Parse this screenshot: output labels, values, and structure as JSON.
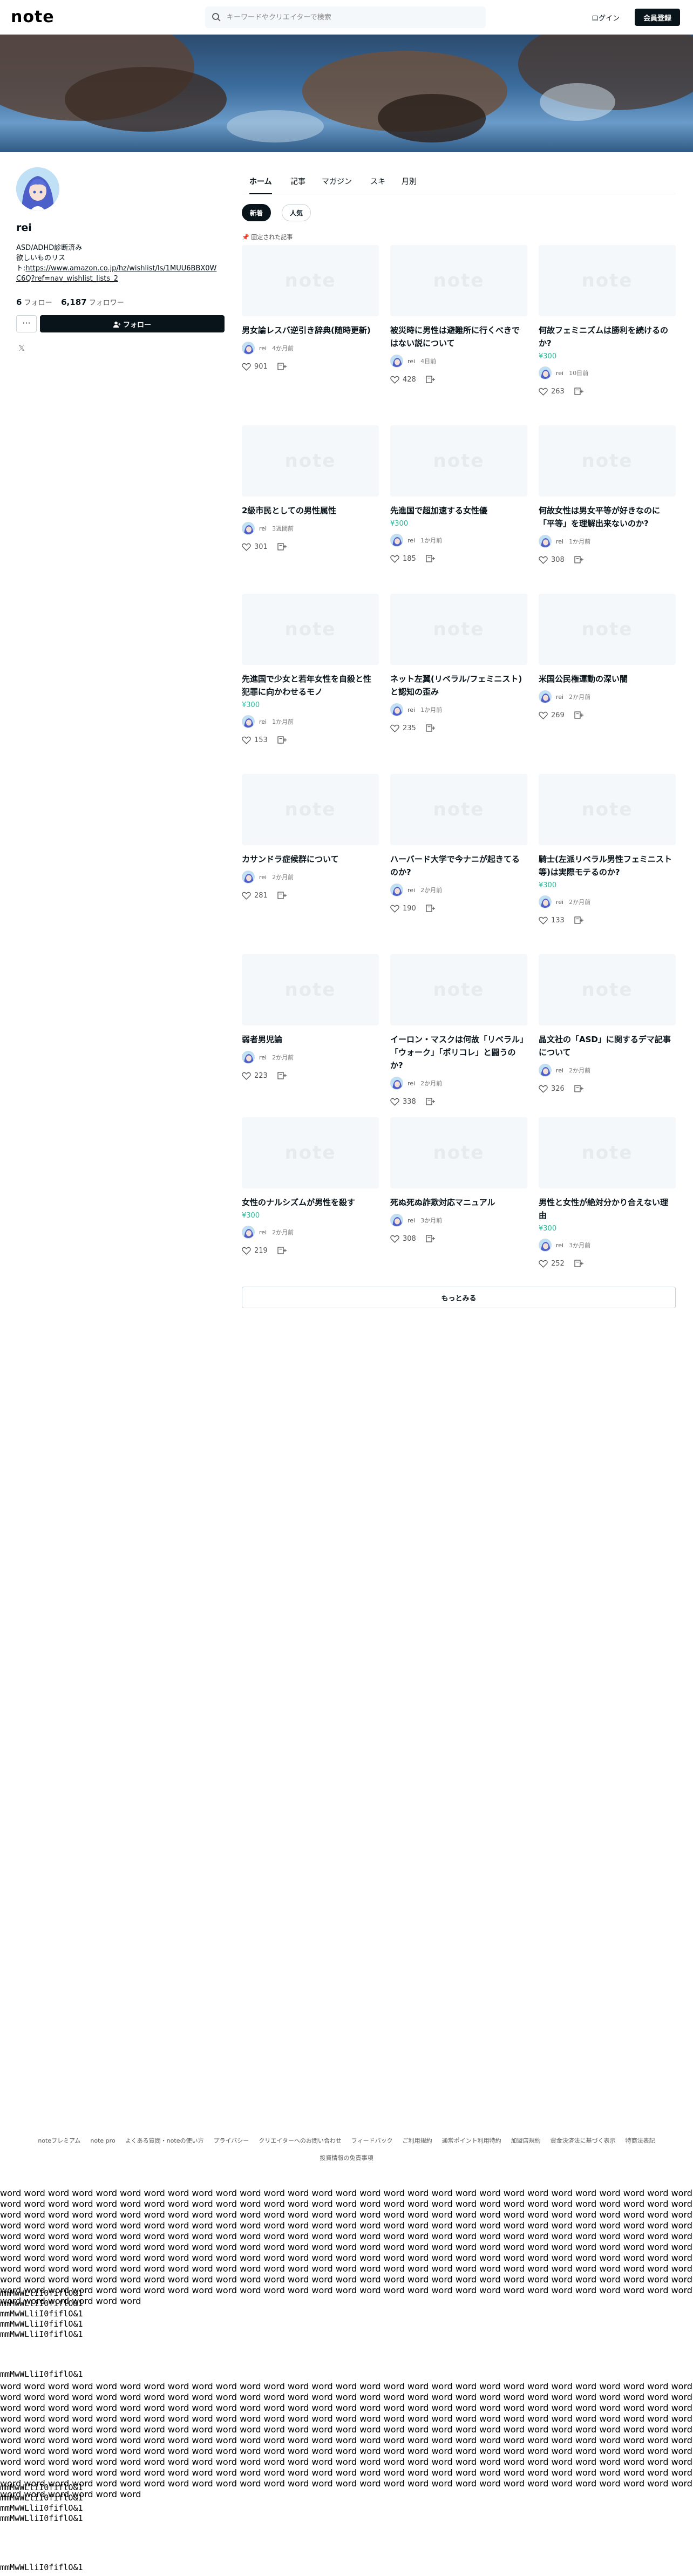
{
  "header": {
    "logo": "note",
    "search_placeholder": "キーワードやクリエイターで検索",
    "login": "ログイン",
    "signup": "会員登録"
  },
  "profile": {
    "name": "rei",
    "bio_line1": "ASD/ADHD診断済み",
    "bio_line2": "欲しいものリス",
    "bio_link_prefix": "ト:",
    "bio_link": "https://www.amazon.co.jp/hz/wishlist/ls/1MUU6BBX0WC6Q?ref=nav_wishlist_lists_2",
    "follow_count": "6",
    "follow_label": "フォロー",
    "follower_count": "6,187",
    "follower_label": "フォロワー",
    "more": "···",
    "follow_button": "フォロー"
  },
  "tabs": [
    "ホーム",
    "記事",
    "マガジン",
    "スキ",
    "月別"
  ],
  "subtabs": [
    "新着",
    "人気"
  ],
  "pinned_label": "固定された記事",
  "thumb_logo": "note",
  "articles": [
    {
      "title": "男女論レスバ逆引き辞典(随時更新)",
      "price": "",
      "author": "rei",
      "date": "4か月前",
      "likes": "901"
    },
    {
      "title": "被災時に男性は避難所に行くべきではない説について",
      "price": "",
      "author": "rei",
      "date": "4日前",
      "likes": "428"
    },
    {
      "title": "何故フェミニズムは勝利を続けるのか?",
      "price": "¥300",
      "author": "rei",
      "date": "10日前",
      "likes": "263"
    },
    {
      "title": "2級市民としての男性属性",
      "price": "",
      "author": "rei",
      "date": "3週間前",
      "likes": "301"
    },
    {
      "title": "先進国で超加速する女性優",
      "price": "¥300",
      "author": "rei",
      "date": "1か月前",
      "likes": "185"
    },
    {
      "title": "何故女性は男女平等が好きなのに「平等」を理解出来ないのか?",
      "price": "",
      "author": "rei",
      "date": "1か月前",
      "likes": "308"
    },
    {
      "title": "先進国で少女と若年女性を自殺と性犯罪に向かわせるモノ",
      "price": "¥300",
      "author": "rei",
      "date": "1か月前",
      "likes": "153"
    },
    {
      "title": "ネット左翼(リベラル/フェミニスト)と認知の歪み",
      "price": "",
      "author": "rei",
      "date": "1か月前",
      "likes": "235"
    },
    {
      "title": "米国公民権運動の深い闇",
      "price": "",
      "author": "rei",
      "date": "2か月前",
      "likes": "269"
    },
    {
      "title": "カサンドラ症候群について",
      "price": "",
      "author": "rei",
      "date": "2か月前",
      "likes": "281"
    },
    {
      "title": "ハーバード大学で今ナニが起きてるのか?",
      "price": "",
      "author": "rei",
      "date": "2か月前",
      "likes": "190"
    },
    {
      "title": "騎士(左派リベラル男性フェミニスト等)は実際モテるのか?",
      "price": "¥300",
      "author": "rei",
      "date": "2か月前",
      "likes": "133"
    },
    {
      "title": "弱者男児論",
      "price": "",
      "author": "rei",
      "date": "2か月前",
      "likes": "223"
    },
    {
      "title": "イーロン・マスクは何故「リベラル」「ウォーク」「ポリコレ」と闘うのか?",
      "price": "",
      "author": "rei",
      "date": "2か月前",
      "likes": "338"
    },
    {
      "title": "晶文社の「ASD」に関するデマ記事について",
      "price": "",
      "author": "rei",
      "date": "2か月前",
      "likes": "326"
    },
    {
      "title": "女性のナルシズムが男性を殺す",
      "price": "¥300",
      "author": "rei",
      "date": "2か月前",
      "likes": "219"
    },
    {
      "title": "死ぬ死ぬ詐欺対応マニュアル",
      "price": "",
      "author": "rei",
      "date": "3か月前",
      "likes": "308"
    },
    {
      "title": "男性と女性が絶対分かり合えない理由",
      "price": "¥300",
      "author": "rei",
      "date": "3か月前",
      "likes": "252"
    }
  ],
  "load_more": "もっとみる",
  "footer": {
    "row1": [
      "noteプレミアム",
      "note pro",
      "よくある質問・noteの使い方",
      "プライバシー",
      "クリエイターへのお問い合わせ",
      "フィードバック",
      "ご利用規約",
      "通常ポイント利用特約",
      "加盟店規約",
      "資金決済法に基づく表示",
      "特商法表記"
    ],
    "row2": [
      "投資情報の免責事項"
    ]
  },
  "debug": {
    "word_block": "word word word word word word word word word word word word word word word word word word word word word word word word word word word word word word word word word word word word word word word word word word word word word word word word word word word word word word word word word word word word word word word word word word word word word word word word word word word word word word word word word word word word word word word word word word word word word word word word word word word word word word word word word word word word word word word word word word word word word word word word word word word word word word word word word word word word word word word word word word word word word word word word word word word word word word word word word word word word word word word word word word word word word word word word word word word word word word word word word word word word word word word word word word word word word word word word word word word word word word word word word word word word word word word word word word word word word word word word word word word word word word word word word word word word word word word word word word word word word word word word word word word word word word word word word word word word word word word word word word word word word word word word word word word word word word word word word word word word word word word word word word word word word word word word word word word word word word word word",
    "glyph_lines_a": [
      "mmMwWLliI0fiflO&1",
      "mmMwWLliI0fiflO&1",
      "mmMwWLliI0fiflO&1",
      "mmMwWLliI0fiflO&1",
      "mmMwWLliI0fiflO&1"
    ],
    "glyph_line_single": "mmMwWLliI0fiflO&1",
    "glyph_lines_b": [
      "mmMwWLliI0fiflO&1",
      "mmMwWLliI0fiflO&1",
      "mmMwWLliI0fiflO&1",
      "mmMwWLliI0fiflO&1"
    ],
    "glyph_line_last": "mmMwWLliI0fiflO&1"
  }
}
